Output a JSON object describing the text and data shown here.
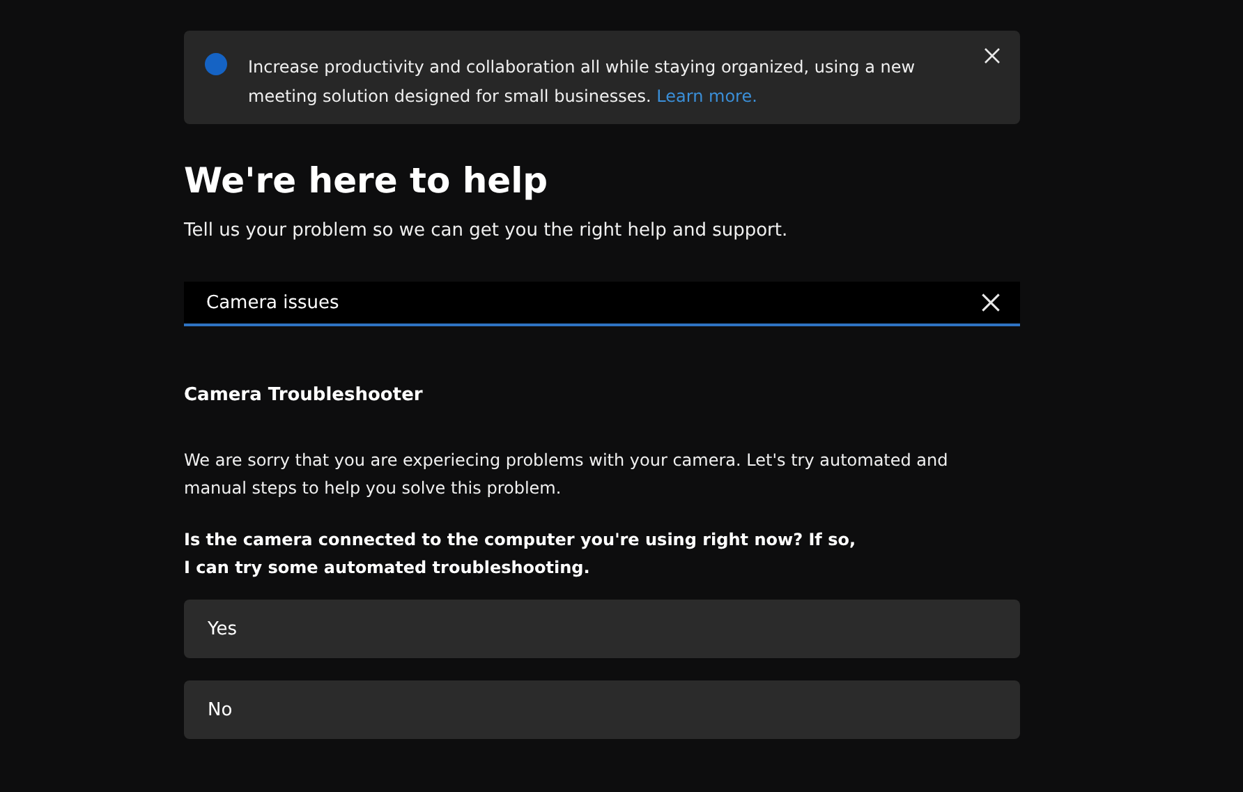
{
  "banner": {
    "text": "Increase productivity and collaboration all while staying organized, using a new meeting solution designed for small businesses.",
    "link": "Learn more."
  },
  "heading": "We're here to help",
  "subtitle": "Tell us your problem so we can get you the right help and support.",
  "search": {
    "value": "Camera issues"
  },
  "troubleshooter": {
    "title": "Camera Troubleshooter",
    "description": "We are sorry that you are experiecing problems with your camera. Let's try automated and manual steps to help you solve this problem.",
    "question": "Is the camera connected to the computer you're using right now? If so, I can try some automated troubleshooting."
  },
  "options": [
    {
      "label": "Yes"
    },
    {
      "label": "No"
    }
  ]
}
